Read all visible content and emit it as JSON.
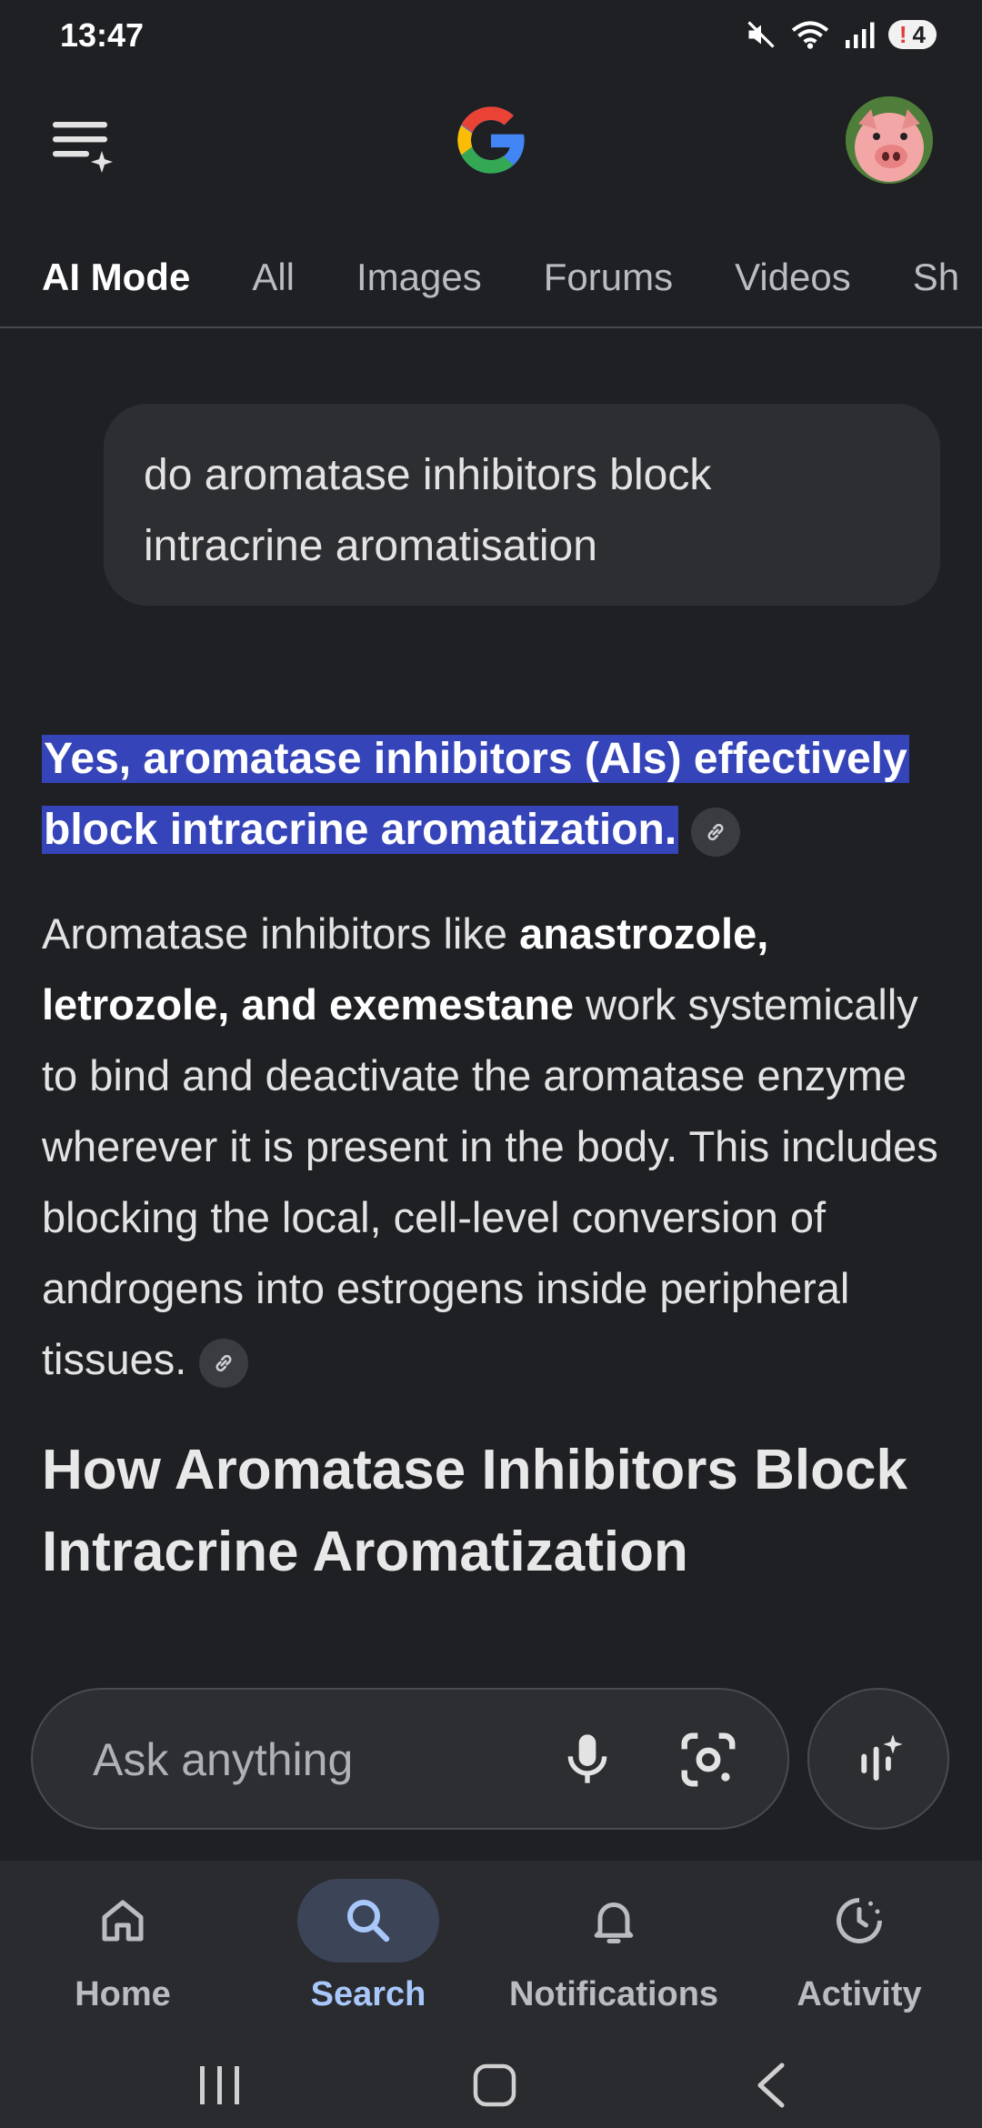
{
  "status_bar": {
    "time": "13:47",
    "notification_count": "4",
    "badge_mark": "!"
  },
  "header": {
    "menu_icon": "menu-sparkle-icon",
    "logo": "google-g-logo",
    "avatar": "pig-avatar"
  },
  "tabs": [
    {
      "label": "AI Mode",
      "active": true
    },
    {
      "label": "All"
    },
    {
      "label": "Images"
    },
    {
      "label": "Forums"
    },
    {
      "label": "Videos"
    },
    {
      "label": "Sh"
    }
  ],
  "query": "do aromatase inhibitors block intracrine aromatisation",
  "answer": {
    "highlight": "Yes, aromatase inhibitors (AIs) effectively block intracrine aromatization.",
    "para_prefix": "Aromatase inhibitors like ",
    "para_bold": "anastrozole, letrozole, and exemestane",
    "para_suffix": " work systemically to bind and deactivate the aromatase enzyme wherever it is present in the body. This includes blocking the local, cell-level conversion of androgens into estrogens inside peripheral tissues.",
    "heading": "How Aromatase Inhibitors Block Intracrine Aromatization"
  },
  "ask_bar": {
    "placeholder": "Ask anything"
  },
  "bottom_nav": [
    {
      "label": "Home",
      "icon": "home-icon"
    },
    {
      "label": "Search",
      "icon": "search-icon",
      "active": true
    },
    {
      "label": "Notifications",
      "icon": "bell-icon"
    },
    {
      "label": "Activity",
      "icon": "activity-icon"
    }
  ],
  "colors": {
    "background": "#1f2023",
    "highlight": "#3544b8",
    "active_nav": "#a8c7fa"
  }
}
